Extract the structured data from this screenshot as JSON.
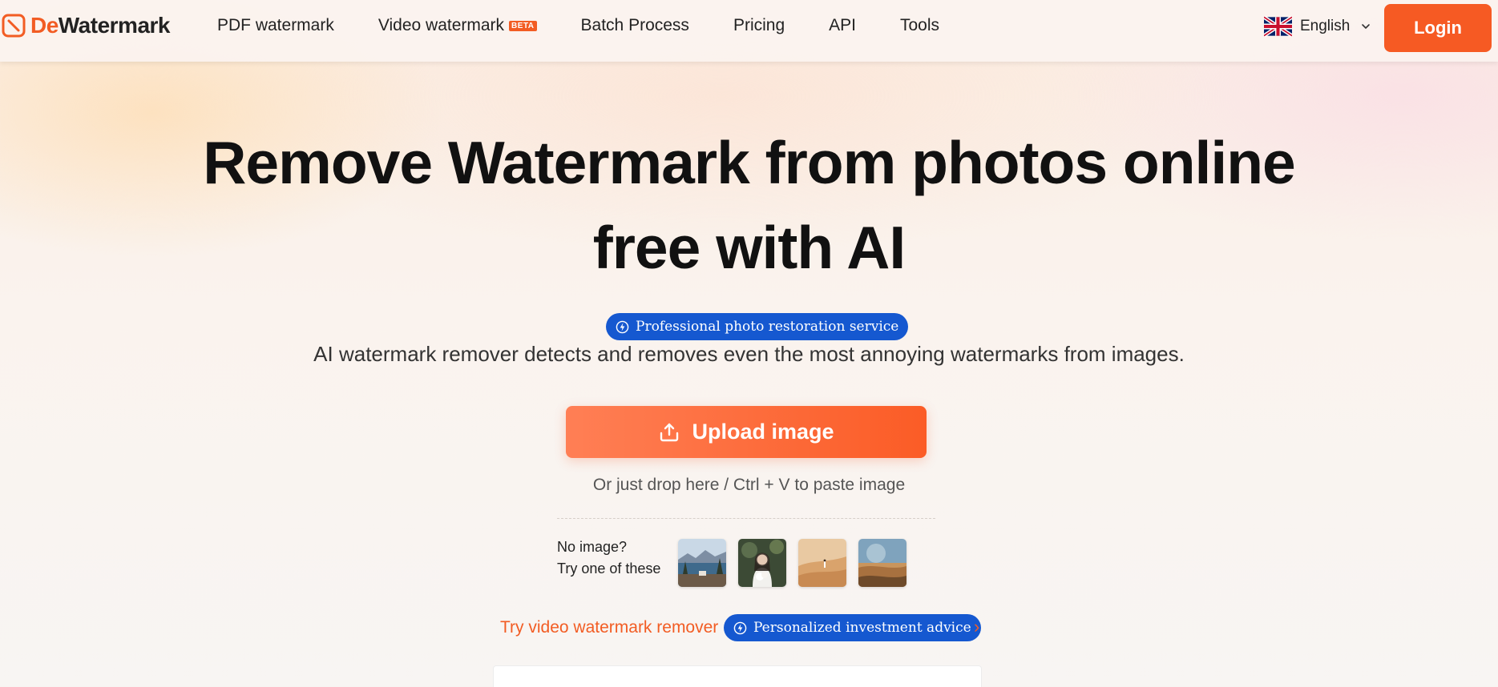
{
  "header": {
    "logo": {
      "prefix": "De",
      "suffix": "Watermark"
    },
    "nav": [
      {
        "label": "PDF watermark"
      },
      {
        "label": "Video watermark",
        "badge": "BETA"
      },
      {
        "label": "Batch Process"
      },
      {
        "label": "Pricing"
      },
      {
        "label": "API"
      },
      {
        "label": "Tools"
      }
    ],
    "language": {
      "label": "English",
      "flag_icon": "uk-flag-icon"
    },
    "login_label": "Login"
  },
  "hero": {
    "title_line1": "Remove Watermark from photos online",
    "title_line2": "free with AI",
    "subtitle": "AI watermark remover detects and removes even the most annoying watermarks from images.",
    "upload_label": "Upload image",
    "drop_hint": "Or just drop here / Ctrl + V to paste image",
    "no_image_line1": "No image?",
    "no_image_line2": "Try one of these",
    "samples": [
      "lake-scene-sample",
      "portrait-sample",
      "desert-sample",
      "sunset-dunes-sample"
    ],
    "video_link": "Try video watermark remover",
    "video_arrow": "›"
  },
  "badges": {
    "badge1": "Professional photo restoration service",
    "badge2": "Personalized investment advice"
  },
  "colors": {
    "brand_orange": "#f65a23",
    "badge_blue": "#1558d0"
  }
}
